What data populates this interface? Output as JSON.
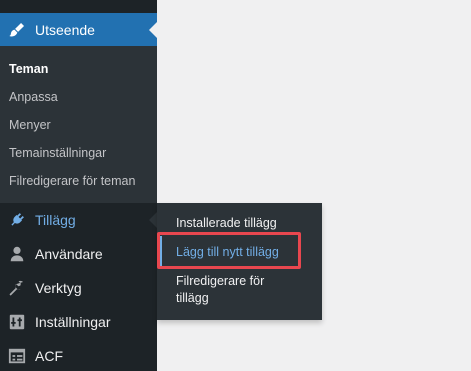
{
  "sidebar": {
    "active_menu": {
      "label": "Utseende",
      "icon": "paintbrush-icon"
    },
    "submenu": [
      {
        "label": "Teman",
        "current": true
      },
      {
        "label": "Anpassa"
      },
      {
        "label": "Menyer"
      },
      {
        "label": "Temainställningar"
      },
      {
        "label": "Filredigerare för teman"
      }
    ],
    "menu": [
      {
        "label": "Tillägg",
        "icon": "plugin-icon",
        "hover": true
      },
      {
        "label": "Användare",
        "icon": "user-icon"
      },
      {
        "label": "Verktyg",
        "icon": "wrench-icon"
      },
      {
        "label": "Inställningar",
        "icon": "settings-icon"
      },
      {
        "label": "ACF",
        "icon": "acf-icon"
      }
    ]
  },
  "flyout": {
    "items": [
      {
        "label": "Installerade tillägg"
      },
      {
        "label": "Lägg till nytt tillägg",
        "highlighted": true
      },
      {
        "label_line1": "Filredigerare för",
        "label_line2": "tillägg"
      }
    ]
  },
  "colors": {
    "sidebar_bg": "#1d2327",
    "submenu_bg": "#2c3338",
    "accent_blue": "#2271b1",
    "hover_blue": "#72aee6",
    "highlight_red": "#e8474f"
  }
}
